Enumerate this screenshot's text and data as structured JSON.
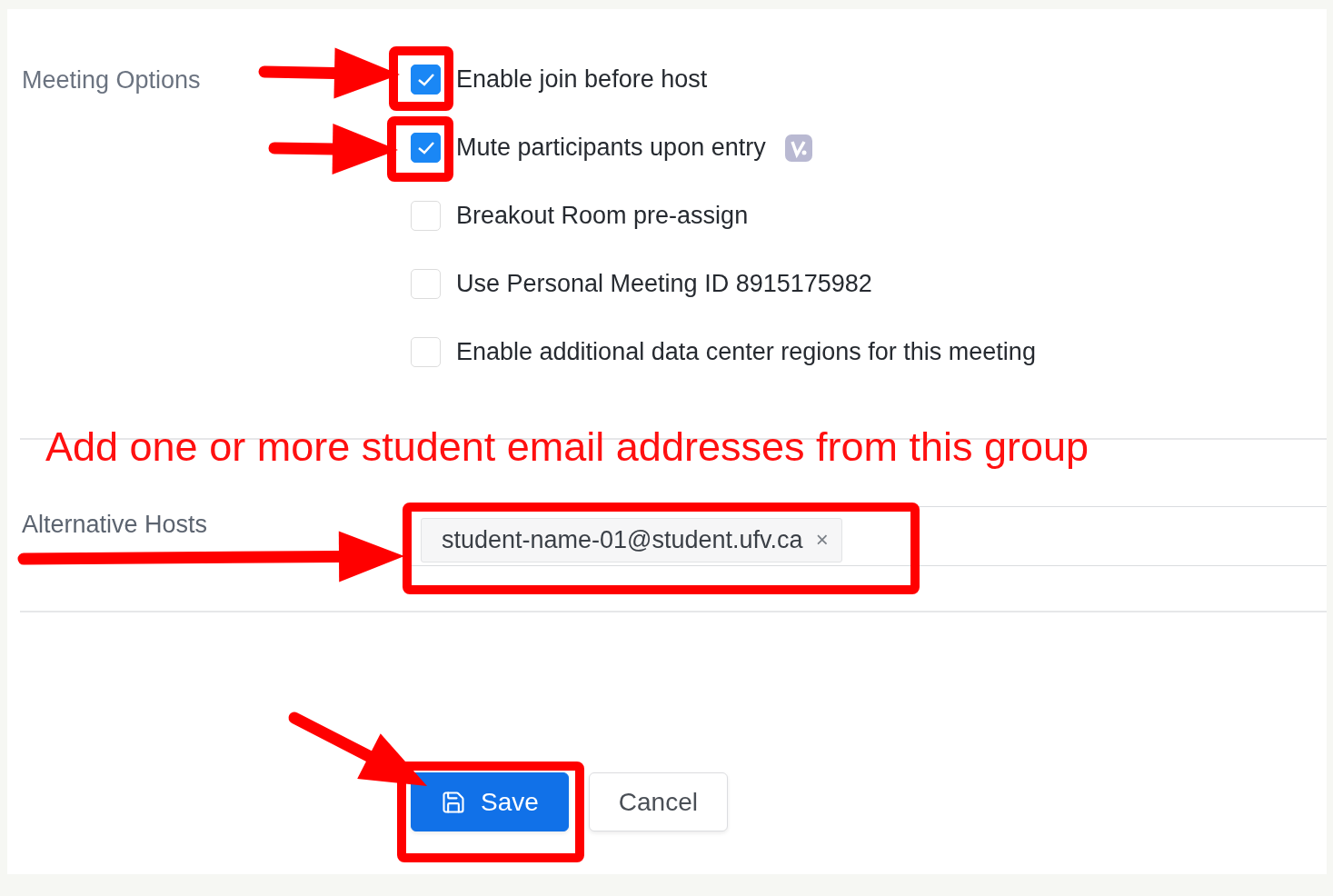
{
  "meeting_options": {
    "label": "Meeting Options",
    "options": [
      {
        "label": "Enable join before host",
        "checked": true,
        "badge": false
      },
      {
        "label": "Mute participants upon entry",
        "checked": true,
        "badge": true
      },
      {
        "label": "Breakout Room pre-assign",
        "checked": false,
        "badge": false
      },
      {
        "label": "Use Personal Meeting ID 8915175982",
        "checked": false,
        "badge": false
      },
      {
        "label": "Enable additional data center regions for this meeting",
        "checked": false,
        "badge": false
      }
    ]
  },
  "annotation": "Add one or more student email addresses from this group",
  "alternative_hosts": {
    "label": "Alternative Hosts",
    "chips": [
      {
        "text": "student-name-01@student.ufv.ca",
        "remove": "×"
      }
    ]
  },
  "buttons": [
    {
      "kind": "primary",
      "label": "Save"
    },
    {
      "kind": "secondary",
      "label": "Cancel"
    }
  ]
}
